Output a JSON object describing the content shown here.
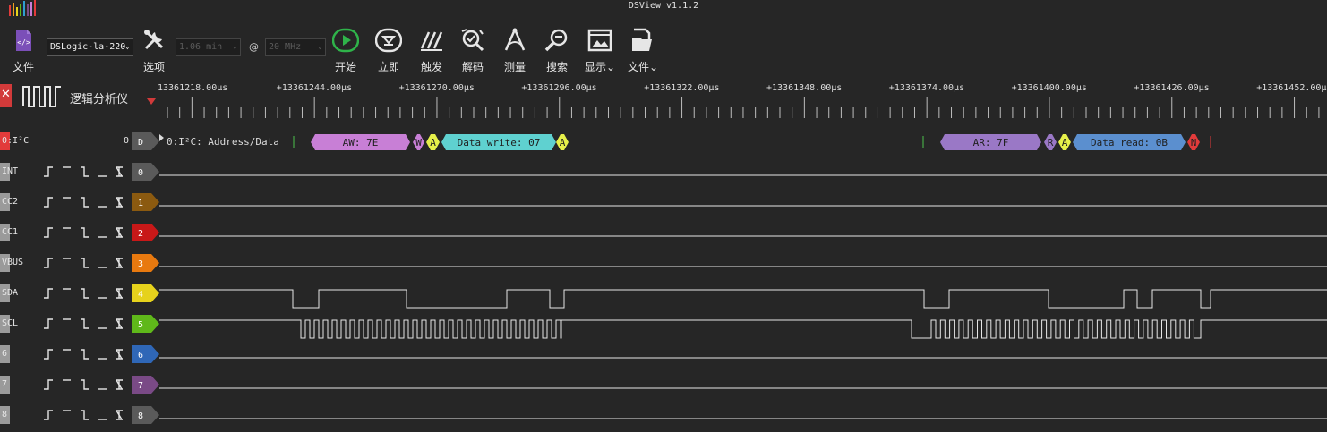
{
  "app": {
    "title": "DSView v1.1.2"
  },
  "colors": {
    "background": "#262626",
    "waveform": "#e6e6e6",
    "play_green": "#2fb34a",
    "decoder_aw": "#c87fd6",
    "decoder_ar": "#9a78c6",
    "decoder_data_write": "#5fd1d0",
    "decoder_data_read": "#5b8fcf",
    "decoder_ack": "#e6f04a",
    "decoder_nack": "#e23b3b"
  },
  "toolbar": {
    "file_label": "文件",
    "device_value": "DSLogic-la-220",
    "options_label": "选项",
    "duration_value": "1.06 min",
    "at_sign": "@",
    "rate_value": "20 MHz",
    "start_label": "开始",
    "instant_label": "立即",
    "trigger_label": "触发",
    "decode_label": "解码",
    "measure_label": "测量",
    "search_label": "搜索",
    "display_label": "显示",
    "file_menu_label": "文件"
  },
  "ruler": {
    "close_glyph": "✕",
    "title": "逻辑分析仪",
    "ticks": [
      "13361218.00μs",
      "+13361244.00μs",
      "+13361270.00μs",
      "+13361296.00μs",
      "+13361322.00μs",
      "+13361348.00μs",
      "+13361374.00μs",
      "+13361400.00μs",
      "+13361426.00μs",
      "+13361452.00μ"
    ]
  },
  "decoder": {
    "name": "0:I²C",
    "index": "0",
    "tag": "D",
    "column_label": "0:I²C: Address/Data",
    "segments": [
      {
        "text": "AW: 7E",
        "kind": "aw"
      },
      {
        "text": "W",
        "kind": "aw"
      },
      {
        "text": "A",
        "kind": "ack"
      },
      {
        "text": "Data write: 07",
        "kind": "data_write"
      },
      {
        "text": "A",
        "kind": "ack"
      },
      {
        "text": "AR: 7F",
        "kind": "ar"
      },
      {
        "text": "R",
        "kind": "ar"
      },
      {
        "text": "A",
        "kind": "ack"
      },
      {
        "text": "Data read: 0B",
        "kind": "data_read"
      },
      {
        "text": "N",
        "kind": "nack"
      }
    ]
  },
  "channels": [
    {
      "name": "INT",
      "index": "0",
      "color": "#5a5a5a"
    },
    {
      "name": "CC2",
      "index": "1",
      "color": "#8b5a10"
    },
    {
      "name": "CC1",
      "index": "2",
      "color": "#c81818"
    },
    {
      "name": "VBUS",
      "index": "3",
      "color": "#e8790f"
    },
    {
      "name": "SDA",
      "index": "4",
      "color": "#e6d21c"
    },
    {
      "name": "SCL",
      "index": "5",
      "color": "#5fb81a"
    },
    {
      "name": "6",
      "index": "6",
      "color": "#2f67b7"
    },
    {
      "name": "7",
      "index": "7",
      "color": "#7a4a86"
    },
    {
      "name": "8",
      "index": "8",
      "color": "#5a5a5a"
    }
  ]
}
